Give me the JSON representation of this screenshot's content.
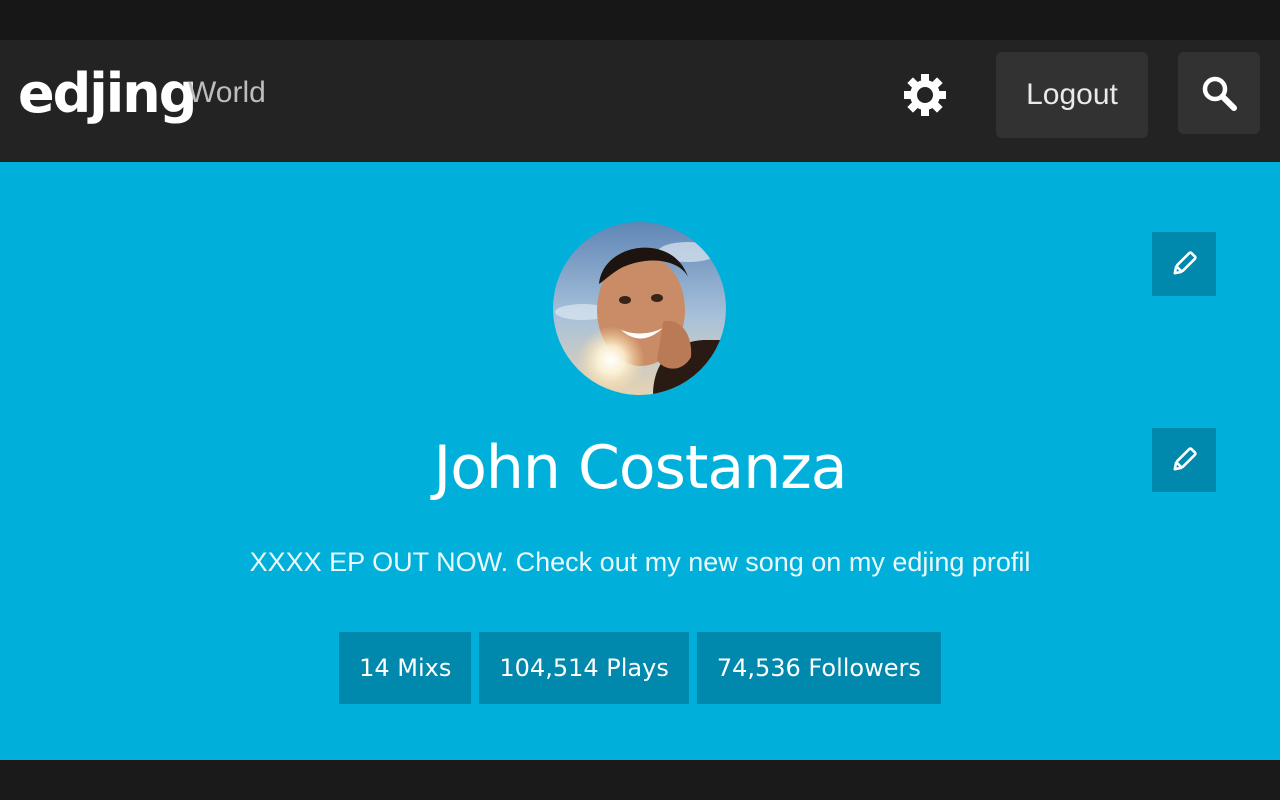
{
  "header": {
    "logo_text": "edjing",
    "section_title": "World",
    "settings_icon": "gear-icon",
    "logout_label": "Logout",
    "search_icon": "search-icon"
  },
  "profile": {
    "name": "John Costanza",
    "bio": "XXXX EP OUT NOW. Check out my new song on my edjing profil",
    "edit_icon": "pencil-icon",
    "stats": [
      {
        "label": "14 Mixs"
      },
      {
        "label": "104,514 Plays"
      },
      {
        "label": "74,536 Followers"
      }
    ]
  },
  "colors": {
    "header_bg": "#232323",
    "profile_bg": "#00b0da",
    "badge_bg": "#0088ad",
    "button_bg": "#323232"
  }
}
